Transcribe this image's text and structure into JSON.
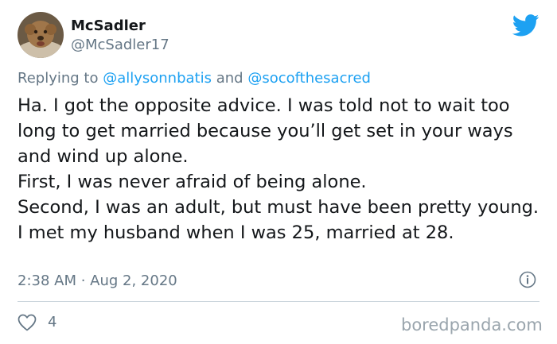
{
  "author": {
    "display_name": "McSadler",
    "handle": "@McSadler17"
  },
  "reply": {
    "prefix": "Replying to ",
    "mention_1": "@allysonnbatis",
    "conjunction": " and ",
    "mention_2": "@socofthesacred"
  },
  "tweet": {
    "paragraphs": [
      "Ha. I got the opposite advice. I was told not to wait too long to get married because you’ll get set in your ways and wind up alone.",
      "First, I was never afraid of being alone.",
      "Second, I was an adult, but must have been pretty young. I met my husband when I was 25, married at 28."
    ],
    "timestamp": "2:38 AM · Aug 2, 2020",
    "like_count": "4"
  },
  "icons": {
    "avatar": "avatar-photo",
    "brand": "twitter-bird-icon",
    "info": "info-icon",
    "like": "heart-icon"
  },
  "colors": {
    "brand_blue": "#1da1f2",
    "secondary_text": "#657786",
    "primary_text": "#14171a"
  },
  "watermark": "boredpanda.com"
}
